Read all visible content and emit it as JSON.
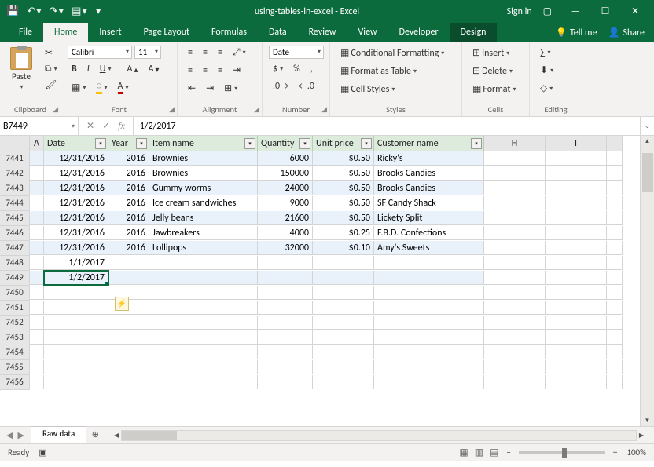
{
  "title": "using-tables-in-excel - Excel",
  "signin": "Sign in",
  "tabs": {
    "file": "File",
    "home": "Home",
    "insert": "Insert",
    "page_layout": "Page Layout",
    "formulas": "Formulas",
    "data": "Data",
    "review": "Review",
    "view": "View",
    "developer": "Developer",
    "design": "Design"
  },
  "tellme": "Tell me",
  "share": "Share",
  "ribbon": {
    "paste": "Paste",
    "font_name": "Calibri",
    "font_size": "11",
    "number_format": "Date",
    "cond_fmt": "Conditional Formatting",
    "fmt_table": "Format as Table",
    "cell_styles": "Cell Styles",
    "insert": "Insert",
    "delete": "Delete",
    "format": "Format",
    "groups": {
      "clipboard": "Clipboard",
      "font": "Font",
      "alignment": "Alignment",
      "number": "Number",
      "styles": "Styles",
      "cells": "Cells",
      "editing": "Editing"
    }
  },
  "namebox": "B7449",
  "formula": "1/2/2017",
  "headers": {
    "A": "A",
    "B": "Date",
    "C": "Year",
    "D": "Item name",
    "E": "Quantity",
    "F": "Unit price",
    "G": "Customer name",
    "H": "H",
    "I": "I"
  },
  "rows": [
    {
      "n": "7441",
      "b": "12/31/2016",
      "c": "2016",
      "d": "Brownies",
      "e": "6000",
      "f": "$0.50",
      "g": "Ricky's",
      "band": true
    },
    {
      "n": "7442",
      "b": "12/31/2016",
      "c": "2016",
      "d": "Brownies",
      "e": "150000",
      "f": "$0.50",
      "g": "Brooks Candies",
      "band": false
    },
    {
      "n": "7443",
      "b": "12/31/2016",
      "c": "2016",
      "d": "Gummy worms",
      "e": "24000",
      "f": "$0.50",
      "g": "Brooks Candies",
      "band": true
    },
    {
      "n": "7444",
      "b": "12/31/2016",
      "c": "2016",
      "d": "Ice cream sandwiches",
      "e": "9000",
      "f": "$0.50",
      "g": "SF Candy Shack",
      "band": false
    },
    {
      "n": "7445",
      "b": "12/31/2016",
      "c": "2016",
      "d": "Jelly beans",
      "e": "21600",
      "f": "$0.50",
      "g": "Lickety Split",
      "band": true
    },
    {
      "n": "7446",
      "b": "12/31/2016",
      "c": "2016",
      "d": "Jawbreakers",
      "e": "4000",
      "f": "$0.25",
      "g": "F.B.D. Confections",
      "band": false
    },
    {
      "n": "7447",
      "b": "12/31/2016",
      "c": "2016",
      "d": "Lollipops",
      "e": "32000",
      "f": "$0.10",
      "g": "Amy's Sweets",
      "band": true
    },
    {
      "n": "7448",
      "b": "1/1/2017",
      "c": "",
      "d": "",
      "e": "",
      "f": "",
      "g": "",
      "band": false
    },
    {
      "n": "7449",
      "b": "1/2/2017",
      "c": "",
      "d": "",
      "e": "",
      "f": "",
      "g": "",
      "band": true,
      "active": true
    },
    {
      "n": "7450",
      "b": "",
      "c": "",
      "d": "",
      "e": "",
      "f": "",
      "g": ""
    },
    {
      "n": "7451",
      "b": "",
      "c": "",
      "d": "",
      "e": "",
      "f": "",
      "g": ""
    },
    {
      "n": "7452",
      "b": "",
      "c": "",
      "d": "",
      "e": "",
      "f": "",
      "g": ""
    },
    {
      "n": "7453",
      "b": "",
      "c": "",
      "d": "",
      "e": "",
      "f": "",
      "g": ""
    },
    {
      "n": "7454",
      "b": "",
      "c": "",
      "d": "",
      "e": "",
      "f": "",
      "g": ""
    },
    {
      "n": "7455",
      "b": "",
      "c": "",
      "d": "",
      "e": "",
      "f": "",
      "g": ""
    },
    {
      "n": "7456",
      "b": "",
      "c": "",
      "d": "",
      "e": "",
      "f": "",
      "g": ""
    }
  ],
  "sheet": "Raw data",
  "status": "Ready",
  "zoom": "100%"
}
